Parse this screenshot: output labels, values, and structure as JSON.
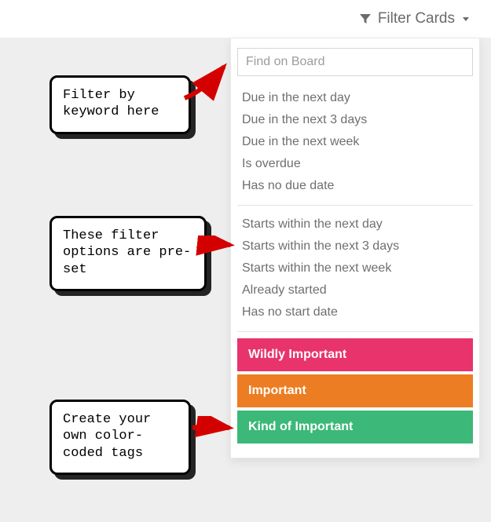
{
  "toolbar": {
    "filter_label": "Filter Cards"
  },
  "search": {
    "placeholder": "Find on Board"
  },
  "due_group": [
    "Due in the next day",
    "Due in the next 3 days",
    "Due in the next week",
    "Is overdue",
    "Has no due date"
  ],
  "start_group": [
    "Starts within the next day",
    "Starts within the next 3 days",
    "Starts within the next week",
    "Already started",
    "Has no start date"
  ],
  "tags": [
    {
      "label": "Wildly Important",
      "color": "#e8336d"
    },
    {
      "label": "Important",
      "color": "#ed7d22"
    },
    {
      "label": "Kind of Important",
      "color": "#3cb878"
    }
  ],
  "annotations": {
    "a1": "Filter by keyword here",
    "a2": "These filter options are pre-set",
    "a3": "Create your own color-coded tags"
  }
}
